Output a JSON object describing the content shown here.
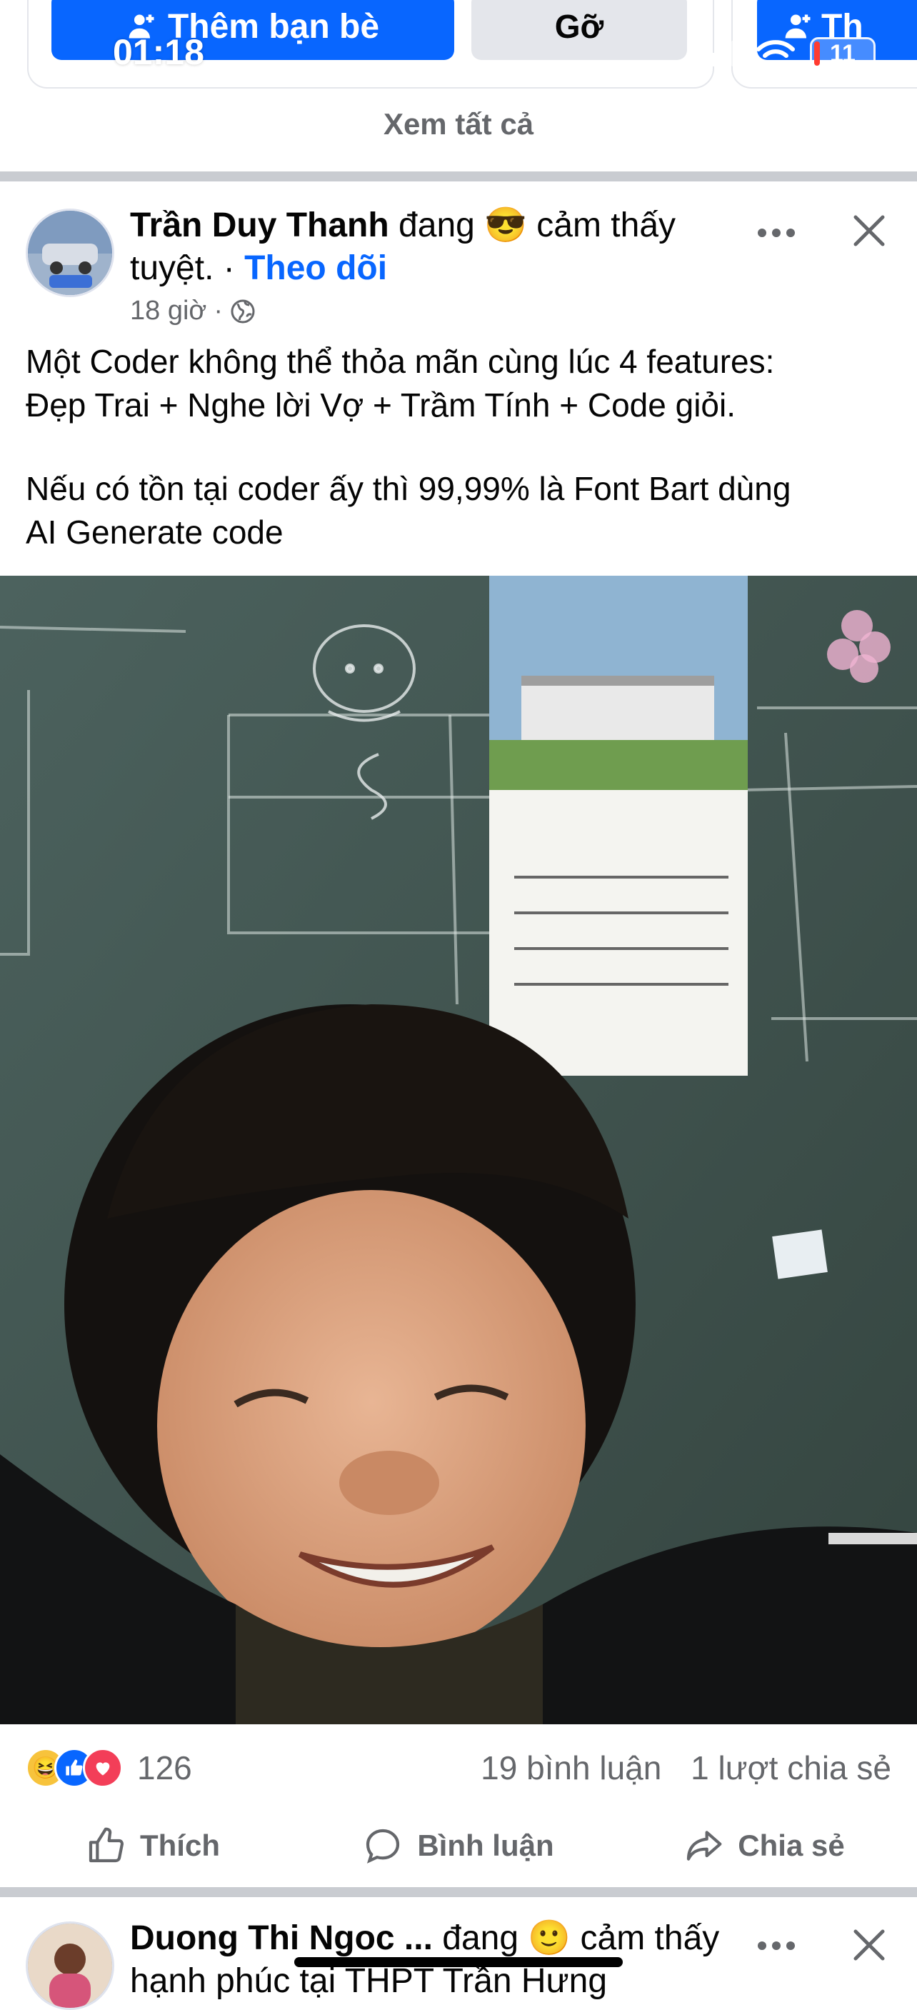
{
  "status_bar": {
    "time": "01:18",
    "battery": "11"
  },
  "suggestions": {
    "add_friend_label": "Thêm bạn bè",
    "remove_label": "Gỡ",
    "add_friend_label_partial": "Th",
    "see_all": "Xem tất cả"
  },
  "post1": {
    "author": "Trần Duy Thanh",
    "feeling_prefix": "đang",
    "feeling_emoji": "😎",
    "feeling_text": "cảm thấy tuyệt.",
    "dot": "·",
    "follow": "Theo dõi",
    "time": "18 giờ",
    "time_dot": "·",
    "text_line1": "Một Coder không thể thỏa mãn cùng lúc 4 features:",
    "text_line2": "Đẹp Trai + Nghe lời Vợ + Trầm Tính + Code giỏi.",
    "text_line3": "Nếu có tồn tại coder ấy thì 99,99% là Font Bart dùng",
    "text_line4": "AI Generate code",
    "reaction_count": "126",
    "comments": "19 bình luận",
    "shares": "1 lượt chia sẻ",
    "actions": {
      "like": "Thích",
      "comment": "Bình luận",
      "share": "Chia sẻ"
    }
  },
  "post2": {
    "author": "Duong Thi Ngoc ...",
    "feeling_prefix": "đang",
    "feeling_emoji": "🙂",
    "feeling_text": "cảm thấy",
    "line2": "hạnh phúc tại THPT Trần Hưng"
  },
  "colors": {
    "accent": "#0866ff",
    "secondary_text": "#65676b",
    "separator": "#c9ccd1"
  },
  "icons": [
    "person-plus-icon",
    "signal-icon",
    "wifi-icon",
    "battery-icon",
    "more-icon",
    "close-icon",
    "globe-icon",
    "like-icon",
    "comment-icon",
    "share-icon"
  ]
}
